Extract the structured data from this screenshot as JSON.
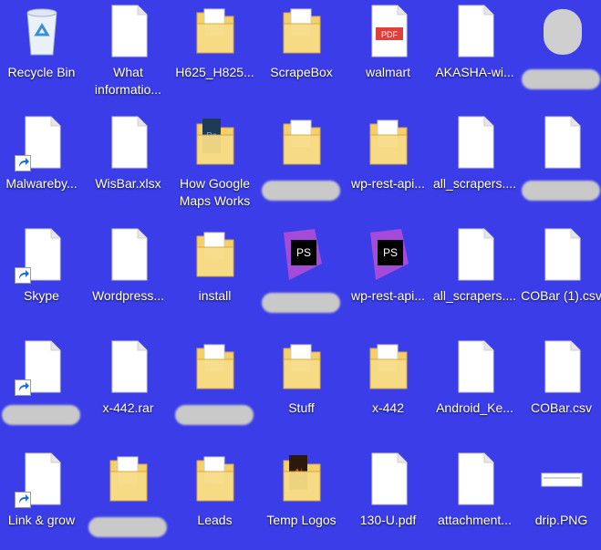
{
  "desktop": {
    "icons": [
      {
        "label": "Recycle Bin",
        "icon": "recycle-bin-icon"
      },
      {
        "label": "What informatio...",
        "icon": "file-icon"
      },
      {
        "label": "H625_H825...",
        "icon": "folder-icon"
      },
      {
        "label": "ScrapeBox",
        "icon": "folder-icon"
      },
      {
        "label": "walmart",
        "icon": "pdf-icon"
      },
      {
        "label": "AKASHA-wi...",
        "icon": "file-icon"
      },
      {
        "label": "",
        "icon": "blurred-icon"
      },
      {
        "label": "Malwareby...",
        "icon": "file-shortcut-icon"
      },
      {
        "label": "WisBar.xlsx",
        "icon": "file-icon"
      },
      {
        "label": "How Google Maps Works",
        "icon": "photoshop-folder-icon"
      },
      {
        "label": "",
        "icon": "folder-icon"
      },
      {
        "label": "wp-rest-api...",
        "icon": "folder-icon"
      },
      {
        "label": "all_scrapers....",
        "icon": "file-icon"
      },
      {
        "label": "",
        "icon": "file-icon"
      },
      {
        "label": "Skype",
        "icon": "file-shortcut-icon"
      },
      {
        "label": "Wordpress...",
        "icon": "file-icon"
      },
      {
        "label": "install",
        "icon": "folder-icon"
      },
      {
        "label": "",
        "icon": "phpstorm-icon"
      },
      {
        "label": "wp-rest-api...",
        "icon": "phpstorm-icon"
      },
      {
        "label": "all_scrapers....",
        "icon": "file-icon"
      },
      {
        "label": "COBar (1).csv",
        "icon": "file-icon"
      },
      {
        "label": "",
        "icon": "file-shortcut-icon"
      },
      {
        "label": "x-442.rar",
        "icon": "file-icon"
      },
      {
        "label": "",
        "icon": "folder-icon"
      },
      {
        "label": "Stuff",
        "icon": "folder-icon"
      },
      {
        "label": "x-442",
        "icon": "folder-icon"
      },
      {
        "label": "Android_Ke...",
        "icon": "file-icon"
      },
      {
        "label": "COBar.csv",
        "icon": "file-icon"
      },
      {
        "label": "Link & grow",
        "icon": "file-shortcut-icon"
      },
      {
        "label": "",
        "icon": "folder-icon"
      },
      {
        "label": "Leads",
        "icon": "folder-icon"
      },
      {
        "label": "Temp Logos",
        "icon": "illustrator-folder-icon"
      },
      {
        "label": "130-U.pdf",
        "icon": "file-icon"
      },
      {
        "label": "attachment...",
        "icon": "file-icon"
      },
      {
        "label": "drip.PNG",
        "icon": "image-icon"
      }
    ],
    "colors": {
      "desktop_bg": "#3b3ee8",
      "folder": "#f4cf6a",
      "pdf_red": "#e0403a",
      "ps_blue": "#1e3a57",
      "ai_orange": "#e87b22",
      "phpstorm_purple": "#a54bd9"
    }
  }
}
